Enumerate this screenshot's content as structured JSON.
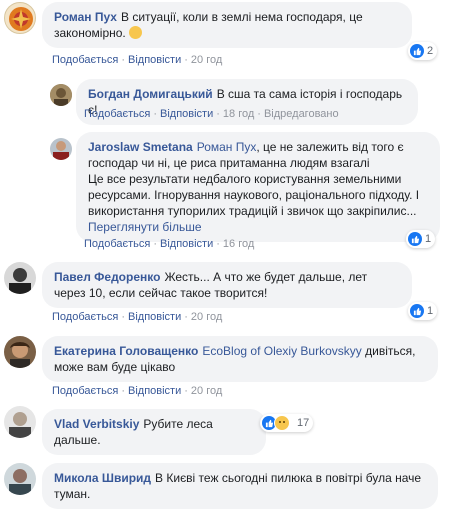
{
  "actions": {
    "like": "Подобається",
    "reply": "Відповісти",
    "edited": "Відредаговано"
  },
  "comments": [
    {
      "author": "Роман Пух",
      "text": "В ситуації, коли в землі нема господаря, це закономірно.",
      "time": "20 год",
      "reactions": "2"
    },
    {
      "author": "Богдан Домигацький",
      "text": "В сша та сама історія і господарь є!",
      "time": "18 год"
    },
    {
      "author": "Jaroslaw Smetana",
      "mention": "Роман Пух",
      "text": ", це не залежить від того є господар чи ні, це риса притаманна людям взагалі",
      "text2": "Це все результати недбалого користування земельними ресурсами. Ігнорування наукового, раціонального підходу. І використання тупорилих традицій і звичок що закріпилис...",
      "seemore": "Переглянути більше",
      "time": "16 год",
      "reactions": "1"
    },
    {
      "author": "Павел Федоренко",
      "text": "Жесть... А что же будет дальше, лет через 10, если сейчас такое творится!",
      "time": "20 год",
      "reactions": "1"
    },
    {
      "author": "Екатерина Головащенко",
      "mention": "EcoBlog of Olexiy Burkovskyy",
      "text": "дивіться, може вам буде цікаво",
      "time": "20 год"
    },
    {
      "author": "Vlad Verbitskiy",
      "text": "Рубите леса дальше.",
      "reactions": "17"
    },
    {
      "author": "Микола Швирид",
      "text": "В Києві теж сьогодні пилюка в повітрі була наче туман."
    }
  ]
}
